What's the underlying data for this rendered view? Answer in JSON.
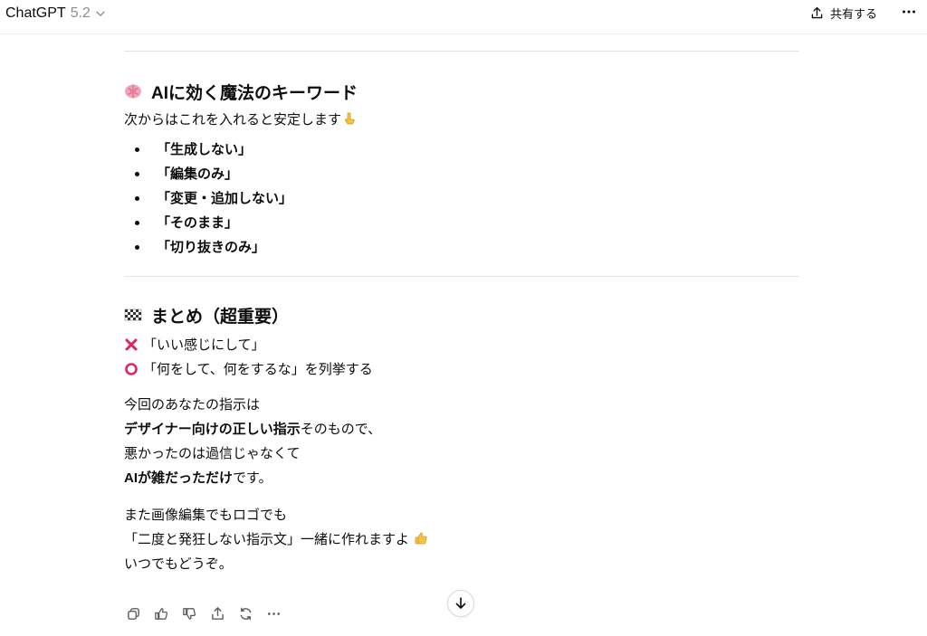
{
  "header": {
    "model_name": "ChatGPT",
    "model_version": "5.2",
    "share_label": "共有する",
    "icons": [
      "chevron-down-icon",
      "share-icon",
      "more-horizontal-icon"
    ]
  },
  "section1": {
    "heading_emoji": "brain-icon",
    "heading": "AIに効く魔法のキーワード",
    "intro": "次からはこれを入れると安定します",
    "intro_emoji": "pointing-down-icon",
    "items": [
      "「生成しない」",
      "「編集のみ」",
      "「変更・追加しない」",
      "「そのまま」",
      "「切り抜きのみ」"
    ]
  },
  "section2": {
    "heading_emoji": "checkered-flag-icon",
    "heading": "まとめ（超重要）",
    "bad_line": "「いい感じにして」",
    "good_line": "「何をして、何をするな」を列挙する",
    "para1": {
      "l1": "今回のあなたの指示は",
      "l2_bold": "デザイナー向けの正しい指示",
      "l2_rest": "そのもので、",
      "l3": "悪かったのは過信じゃなくて",
      "l4_bold": "AIが雑だっただけ",
      "l4_rest": "です。"
    },
    "para2": {
      "l1": "また画像編集でもロゴでも",
      "l2": "「二度と発狂しない指示文」一緒に作れますよ",
      "l2_emoji": "thumbs-up-icon",
      "l3": "いつでもどうぞ。"
    }
  },
  "actions": [
    "copy-icon",
    "thumbs-up-icon",
    "thumbs-down-icon",
    "share-icon",
    "regenerate-icon",
    "more-horizontal-icon"
  ],
  "colors": {
    "text": "#0d0d0d",
    "muted": "#8f8f8f",
    "divider": "#e3e3e3",
    "cross": "#e0245e",
    "circle": "#e0245e"
  }
}
